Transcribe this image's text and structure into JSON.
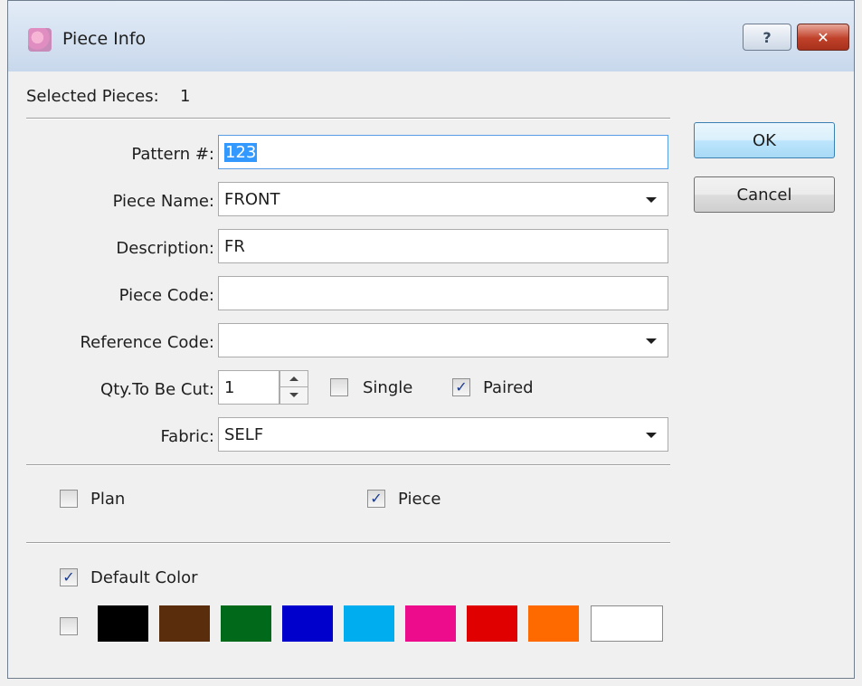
{
  "window": {
    "title": "Piece Info",
    "help_label": "?",
    "close_label": "✕"
  },
  "selected": {
    "label": "Selected Pieces:",
    "value": "1"
  },
  "fields": {
    "pattern": {
      "label": "Pattern #:",
      "value": "123"
    },
    "piece_name": {
      "label": "Piece Name:",
      "value": "FRONT"
    },
    "description": {
      "label": "Description:",
      "value": "FR"
    },
    "piece_code": {
      "label": "Piece Code:",
      "value": ""
    },
    "reference_code": {
      "label": "Reference Code:",
      "value": ""
    },
    "qty": {
      "label": "Qty.To Be Cut:",
      "value": "1"
    },
    "fabric": {
      "label": "Fabric:",
      "value": "SELF"
    }
  },
  "options": {
    "single": {
      "label": "Single",
      "checked": false
    },
    "paired": {
      "label": "Paired",
      "checked": true
    },
    "plan": {
      "label": "Plan",
      "checked": false
    },
    "piece": {
      "label": "Piece",
      "checked": true
    },
    "default_color": {
      "label": "Default Color",
      "checked": true
    },
    "custom_color": {
      "checked": false
    }
  },
  "buttons": {
    "ok": "OK",
    "cancel": "Cancel"
  },
  "colors": [
    {
      "name": "black",
      "hex": "#000000"
    },
    {
      "name": "brown",
      "hex": "#5a2d0c"
    },
    {
      "name": "green",
      "hex": "#006a1a"
    },
    {
      "name": "blue",
      "hex": "#0000cc"
    },
    {
      "name": "light-blue",
      "hex": "#00adef"
    },
    {
      "name": "pink",
      "hex": "#ec0c8c"
    },
    {
      "name": "red",
      "hex": "#e00000"
    },
    {
      "name": "orange",
      "hex": "#ff6a00"
    },
    {
      "name": "white",
      "hex": "#ffffff"
    }
  ],
  "check_glyph": "✓"
}
